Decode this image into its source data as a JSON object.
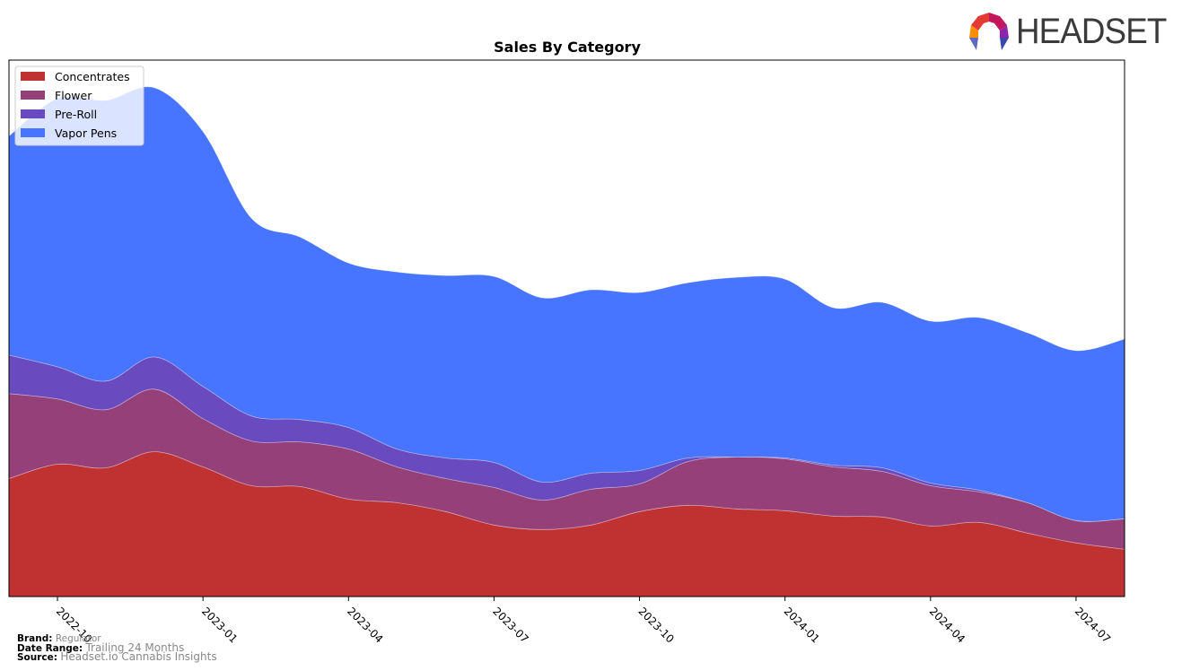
{
  "brand_logo": {
    "text": "HEADSET"
  },
  "footer": {
    "brand_label": "Brand:",
    "brand_value": "Regulator",
    "date_range_label": "Date Range:",
    "date_range_value": "Trailing 24 Months",
    "source_label": "Source:",
    "source_value": "Headset.io Cannabis Insights"
  },
  "chart_data": {
    "type": "area",
    "stacked": true,
    "title": "Sales By Category",
    "xlabel": "",
    "ylabel": "",
    "y_units": "relative (no y-axis shown)",
    "grid": false,
    "legend_position": "top-left",
    "x": [
      "2022-09",
      "2022-10",
      "2022-11",
      "2022-12",
      "2023-01",
      "2023-02",
      "2023-03",
      "2023-04",
      "2023-05",
      "2023-06",
      "2023-07",
      "2023-08",
      "2023-09",
      "2023-10",
      "2023-11",
      "2023-12",
      "2024-01",
      "2024-02",
      "2024-03",
      "2024-04",
      "2024-05",
      "2024-06",
      "2024-07",
      "2024-08"
    ],
    "x_ticks": [
      "2022-10",
      "2023-01",
      "2023-04",
      "2023-07",
      "2023-10",
      "2024-01",
      "2024-04",
      "2024-07"
    ],
    "ylim": [
      0,
      600
    ],
    "series": [
      {
        "name": "Concentrates",
        "color": "#c03232",
        "values": [
          132,
          148,
          144,
          162,
          145,
          124,
          123,
          109,
          105,
          95,
          80,
          75,
          80,
          95,
          102,
          98,
          96,
          90,
          89,
          79,
          83,
          71,
          60,
          53
        ]
      },
      {
        "name": "Flower",
        "color": "#96407a",
        "values": [
          95,
          73,
          65,
          70,
          54,
          50,
          50,
          56,
          40,
          37,
          42,
          33,
          40,
          31,
          49,
          58,
          58,
          55,
          51,
          45,
          34,
          34,
          25,
          34
        ]
      },
      {
        "name": "Pre-Roll",
        "color": "#6a4bbf",
        "values": [
          43,
          36,
          32,
          36,
          36,
          28,
          25,
          24,
          20,
          23,
          28,
          20,
          18,
          15,
          4,
          0,
          1,
          2,
          4,
          3,
          2,
          0,
          0,
          0
        ]
      },
      {
        "name": "Vapor Pens",
        "color": "#4775ff",
        "values": [
          245,
          300,
          314,
          301,
          285,
          221,
          204,
          184,
          198,
          204,
          208,
          206,
          205,
          199,
          196,
          201,
          200,
          176,
          185,
          181,
          193,
          190,
          190,
          201
        ]
      }
    ]
  }
}
